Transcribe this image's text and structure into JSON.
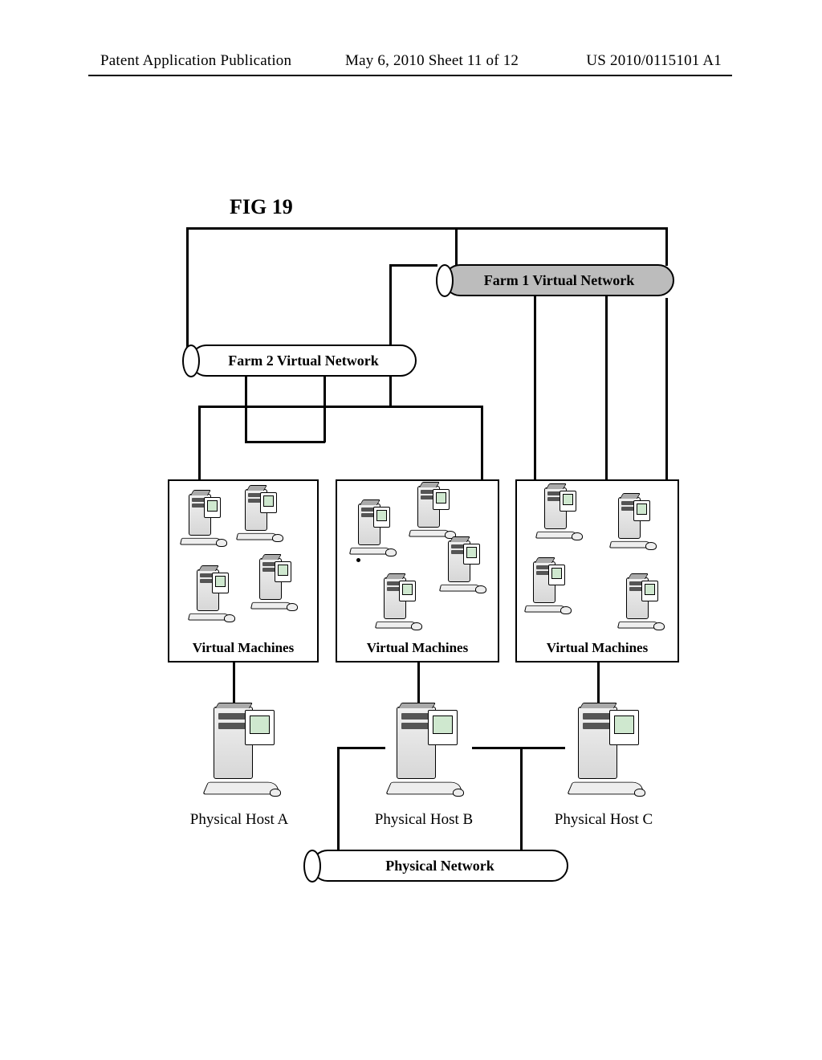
{
  "header": {
    "left": "Patent Application Publication",
    "middle": "May 6, 2010  Sheet 11 of 12",
    "right": "US 2010/0115101 A1"
  },
  "figure_title": "FIG 19",
  "networks": {
    "farm1": "Farm 1 Virtual Network",
    "farm2": "Farm 2 Virtual Network",
    "physical": "Physical Network"
  },
  "vm_groups": {
    "a": "Virtual Machines",
    "b": "Virtual Machines",
    "c": "Virtual Machines"
  },
  "hosts": {
    "a": "Physical Host A",
    "b": "Physical Host B",
    "c": "Physical Host C"
  }
}
